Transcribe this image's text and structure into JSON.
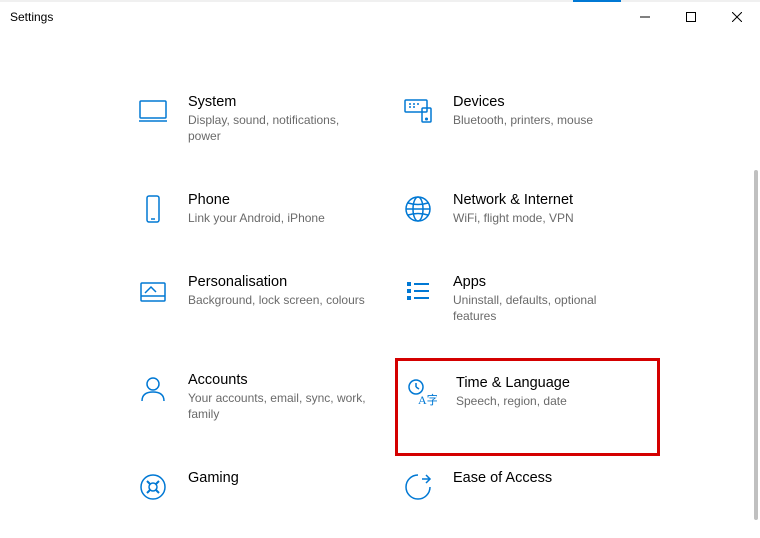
{
  "window": {
    "title": "Settings"
  },
  "tiles": [
    {
      "title": "System",
      "desc": "Display, sound, notifications, power"
    },
    {
      "title": "Devices",
      "desc": "Bluetooth, printers, mouse"
    },
    {
      "title": "Phone",
      "desc": "Link your Android, iPhone"
    },
    {
      "title": "Network & Internet",
      "desc": "WiFi, flight mode, VPN"
    },
    {
      "title": "Personalisation",
      "desc": "Background, lock screen, colours"
    },
    {
      "title": "Apps",
      "desc": "Uninstall, defaults, optional features"
    },
    {
      "title": "Accounts",
      "desc": "Your accounts, email, sync, work, family"
    },
    {
      "title": "Time & Language",
      "desc": "Speech, region, date",
      "highlighted": true
    },
    {
      "title": "Gaming",
      "desc": ""
    },
    {
      "title": "Ease of Access",
      "desc": ""
    }
  ]
}
